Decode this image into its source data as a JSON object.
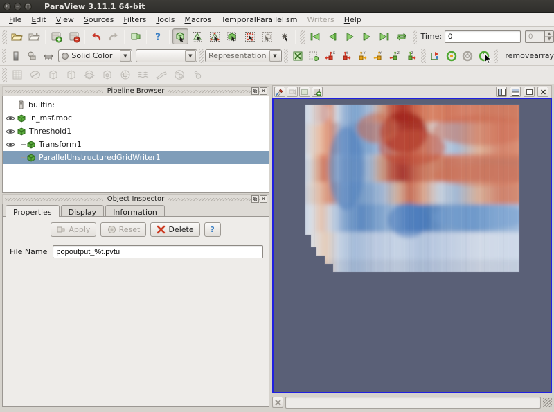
{
  "window": {
    "title": "ParaView 3.11.1 64-bit",
    "controls": [
      {
        "name": "close-window-button",
        "glyph": "✕"
      },
      {
        "name": "minimize-window-button",
        "glyph": "−"
      },
      {
        "name": "maximize-window-button",
        "glyph": "□"
      }
    ]
  },
  "menubar": {
    "items": [
      {
        "label": "File",
        "mnemonic": "F",
        "disabled": false
      },
      {
        "label": "Edit",
        "mnemonic": "E",
        "disabled": false
      },
      {
        "label": "View",
        "mnemonic": "V",
        "disabled": false
      },
      {
        "label": "Sources",
        "mnemonic": "S",
        "disabled": false
      },
      {
        "label": "Filters",
        "mnemonic": "F",
        "disabled": false
      },
      {
        "label": "Tools",
        "mnemonic": "T",
        "disabled": false
      },
      {
        "label": "Macros",
        "mnemonic": "M",
        "disabled": false
      },
      {
        "label": "TemporalParallelism",
        "mnemonic": "",
        "disabled": false
      },
      {
        "label": "Writers",
        "mnemonic": "",
        "disabled": true
      },
      {
        "label": "Help",
        "mnemonic": "H",
        "disabled": false
      }
    ]
  },
  "toolbar_main": {
    "buttons": [
      {
        "name": "open-file-icon",
        "tip": "Open"
      },
      {
        "name": "recent-files-icon",
        "tip": "Recent Files"
      },
      {
        "name": "save-state-icon",
        "tip": "Save State"
      },
      {
        "name": "load-state-icon",
        "tip": "Load State"
      },
      {
        "name": "undo-icon",
        "tip": "Undo"
      },
      {
        "name": "redo-icon",
        "tip": "Redo"
      },
      {
        "name": "connect-server-icon",
        "tip": "Connect"
      },
      {
        "name": "help-icon",
        "tip": "Help"
      }
    ],
    "selection_buttons": [
      {
        "name": "interact-cube-icon",
        "tip": "Interact",
        "active": true
      },
      {
        "name": "select-cells-surface-icon",
        "tip": "Select Cells On"
      },
      {
        "name": "select-points-surface-icon",
        "tip": "Select Points On"
      },
      {
        "name": "select-cells-through-icon",
        "tip": "Select Cells Through"
      },
      {
        "name": "select-points-through-icon",
        "tip": "Select Points Through"
      },
      {
        "name": "select-block-icon",
        "tip": "Select Block"
      },
      {
        "name": "quick-select-icon",
        "tip": "Quick Select"
      }
    ],
    "vcr_buttons": [
      {
        "name": "first-frame-icon",
        "tip": "First Frame"
      },
      {
        "name": "previous-frame-icon",
        "tip": "Previous Frame"
      },
      {
        "name": "play-icon",
        "tip": "Play"
      },
      {
        "name": "next-frame-icon",
        "tip": "Next Frame"
      },
      {
        "name": "last-frame-icon",
        "tip": "Last Frame"
      },
      {
        "name": "loop-icon",
        "tip": "Loop"
      }
    ],
    "time_label": "Time:",
    "time_value": "0",
    "time_index_value": "0"
  },
  "toolbar_representation": {
    "buttons": [
      {
        "name": "edit-color-map-icon",
        "tip": "Edit Color Map"
      },
      {
        "name": "rescale-to-data-range-icon",
        "tip": "Rescale To Data Range"
      },
      {
        "name": "rescale-custom-range-icon",
        "tip": "Rescale To Custom Range"
      }
    ],
    "color_by": "Solid Color",
    "component": "",
    "representation": "Representation",
    "camera_buttons": [
      {
        "name": "reset-camera-icon",
        "tip": "Reset Camera"
      },
      {
        "name": "zoom-to-box-icon",
        "tip": "Zoom To Box"
      },
      {
        "name": "set-view-minus-x-icon",
        "tip": "+X"
      },
      {
        "name": "set-view-plus-x-icon",
        "tip": "-X"
      },
      {
        "name": "set-view-plus-y-icon",
        "tip": "+Y"
      },
      {
        "name": "set-view-minus-y-icon",
        "tip": "-Y"
      },
      {
        "name": "set-view-plus-z-icon",
        "tip": "+Z"
      },
      {
        "name": "set-view-minus-z-icon",
        "tip": "-Z"
      }
    ],
    "rotate_buttons": [
      {
        "name": "center-axes-icon",
        "tip": "Show Center"
      },
      {
        "name": "rotate-90-ccw-icon",
        "tip": "Rotate 90 CCW"
      },
      {
        "name": "pick-center-icon",
        "tip": "Pick Center"
      },
      {
        "name": "rotate-90-cw-icon",
        "tip": "Rotate 90 CW"
      }
    ],
    "macro_name": "removearray"
  },
  "toolbar_sources": {
    "buttons": [
      {
        "name": "spreadsheet-icon",
        "tip": "Spreadsheet View"
      },
      {
        "name": "calculator-icon",
        "tip": "Calculator"
      },
      {
        "name": "contour-icon",
        "tip": "Contour"
      },
      {
        "name": "clip-icon",
        "tip": "Clip"
      },
      {
        "name": "slice-icon",
        "tip": "Slice"
      },
      {
        "name": "threshold-icon",
        "tip": "Threshold"
      },
      {
        "name": "extract-subset-icon",
        "tip": "Extract Subset"
      },
      {
        "name": "glyph-icon",
        "tip": "Glyph"
      },
      {
        "name": "stream-tracer-icon",
        "tip": "Stream Tracer"
      },
      {
        "name": "warp-icon",
        "tip": "Warp By Vector"
      },
      {
        "name": "group-datasets-icon",
        "tip": "Group Datasets"
      },
      {
        "name": "extract-level-icon",
        "tip": "Extract Level"
      }
    ]
  },
  "pipeline_browser": {
    "title": "Pipeline Browser",
    "dock_buttons": [
      {
        "name": "undock-button",
        "glyph": "⧉"
      },
      {
        "name": "close-panel-button",
        "glyph": "✕"
      }
    ],
    "items": [
      {
        "label": "builtin:",
        "icon": "server-icon",
        "eye": false,
        "indent": 0,
        "selected": false,
        "branch": "none"
      },
      {
        "label": "in_msf.moc",
        "icon": "source-icon",
        "eye": true,
        "indent": 0,
        "selected": false,
        "branch": "none"
      },
      {
        "label": "Threshold1",
        "icon": "source-icon",
        "eye": true,
        "indent": 0,
        "selected": false,
        "branch": "none"
      },
      {
        "label": "Transform1",
        "icon": "source-icon",
        "eye": true,
        "indent": 1,
        "selected": false,
        "branch": "branch"
      },
      {
        "label": "ParallelUnstructuredGridWriter1",
        "icon": "source-icon",
        "eye": false,
        "indent": 1,
        "selected": true,
        "branch": "last"
      }
    ]
  },
  "object_inspector": {
    "title": "Object Inspector",
    "dock_buttons": [
      {
        "name": "undock-button",
        "glyph": "⧉"
      },
      {
        "name": "close-panel-button",
        "glyph": "✕"
      }
    ],
    "tabs": [
      {
        "label": "Properties",
        "active": true
      },
      {
        "label": "Display",
        "active": false
      },
      {
        "label": "Information",
        "active": false
      }
    ],
    "buttons": [
      {
        "label": "Apply",
        "name": "apply-button",
        "disabled": true,
        "icon": "apply-icon"
      },
      {
        "label": "Reset",
        "name": "reset-button",
        "disabled": true,
        "icon": "reset-icon"
      },
      {
        "label": "Delete",
        "name": "delete-button",
        "disabled": false,
        "icon": "delete-icon"
      },
      {
        "label": "?",
        "name": "properties-help-button",
        "disabled": false,
        "icon": "help-icon"
      }
    ],
    "fields": [
      {
        "label": "File Name",
        "value": "popoutput_%t.pvtu",
        "name": "file-name-field"
      }
    ]
  },
  "render_view": {
    "toolbar_left": [
      {
        "name": "adjust-camera-icon",
        "tip": "Adjust Camera"
      },
      {
        "name": "undo-camera-icon",
        "tip": "Undo Camera"
      },
      {
        "name": "capture-screenshot-icon",
        "tip": "Capture Screenshot"
      },
      {
        "name": "reset-view-icon",
        "tip": "Reset"
      }
    ],
    "toolbar_right": [
      {
        "name": "split-horizontal-button",
        "glyph": "‖"
      },
      {
        "name": "split-vertical-button",
        "glyph": "≡"
      },
      {
        "name": "maximize-view-button",
        "glyph": "□"
      },
      {
        "name": "close-view-button",
        "glyph": "✕"
      }
    ],
    "background_color": "#5a6077",
    "border_color": "#2020e0",
    "dataset_description": "cool-to-warm pseudocolor field on a stair-stepped unstructured grid slab"
  },
  "status_bar": {
    "cancel_button_name": "cancel-button",
    "progress_value": "",
    "resize_grip_name": "resize-grip"
  },
  "colors": {
    "accent_blue": "#2020e0",
    "selection_blue": "#7f9db9",
    "panel_bg": "#eeece9",
    "toolbar_bg": "#e9e7e4",
    "titlebar_bg": "#35342f",
    "viewport_bg": "#5a6077",
    "colormap_cold": "#3b4cc0",
    "colormap_mid": "#f2f0ee",
    "colormap_hot": "#b40426"
  }
}
